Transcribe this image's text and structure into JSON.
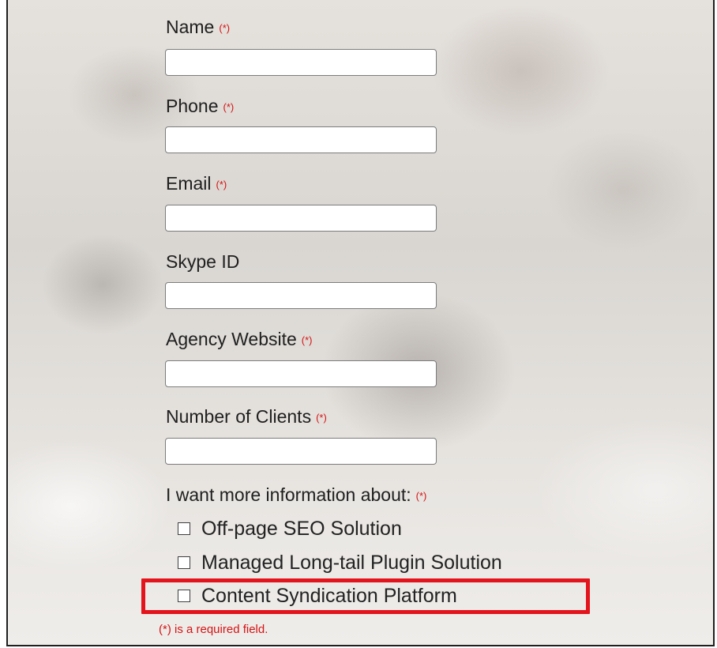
{
  "form": {
    "required_marker": "(*)",
    "fields": [
      {
        "label": "Name",
        "required": true,
        "value": "",
        "placeholder": ""
      },
      {
        "label": "Phone",
        "required": true,
        "value": "",
        "placeholder": ""
      },
      {
        "label": "Email",
        "required": true,
        "value": "",
        "placeholder": ""
      },
      {
        "label": "Skype ID",
        "required": false,
        "value": "",
        "placeholder": ""
      },
      {
        "label": "Agency Website",
        "required": true,
        "value": "",
        "placeholder": ""
      },
      {
        "label": "Number of Clients",
        "required": true,
        "value": "",
        "placeholder": ""
      }
    ],
    "interest": {
      "label": "I want more information about:",
      "required_marker": "(*)",
      "options": [
        {
          "label": "Off-page SEO Solution",
          "checked": false
        },
        {
          "label": "Managed Long-tail Plugin Solution",
          "checked": false
        },
        {
          "label": "Content Syndication Platform",
          "checked": false,
          "highlighted": true
        }
      ]
    },
    "required_note": "(*) is a required field."
  },
  "colors": {
    "required_red": "#d31414",
    "highlight_red": "#e3141c",
    "text": "#202020"
  }
}
